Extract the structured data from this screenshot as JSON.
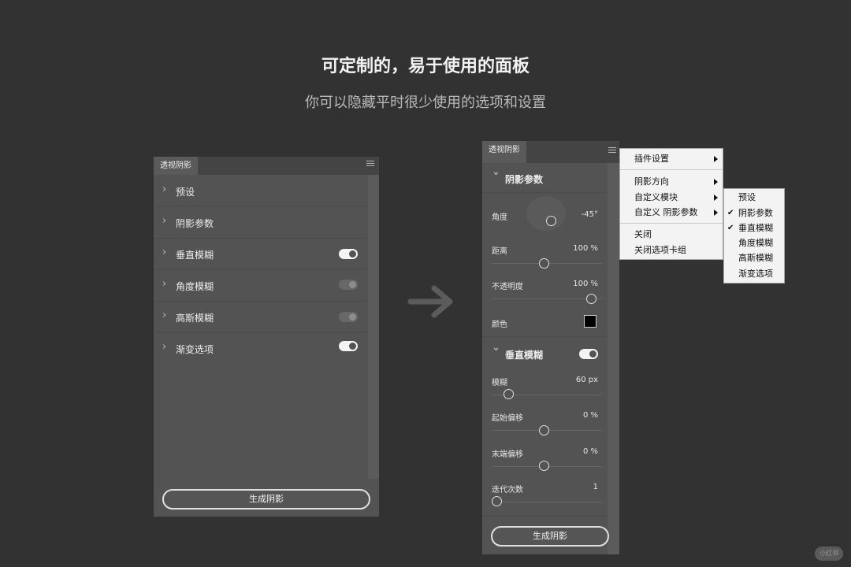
{
  "hero": {
    "title": "可定制的，易于使用的面板",
    "subtitle": "你可以隐藏平时很少使用的选项和设置"
  },
  "simple_panel": {
    "tab_label": "透视阴影",
    "rows": [
      {
        "label": "预设",
        "toggle": null
      },
      {
        "label": "阴影参数",
        "toggle": null
      },
      {
        "label": "垂直模糊",
        "toggle": true
      },
      {
        "label": "角度模糊",
        "toggle": false
      },
      {
        "label": "高斯模糊",
        "toggle": false
      },
      {
        "label": "渐变选项",
        "toggle": true
      }
    ],
    "generate_label": "生成阴影"
  },
  "expanded_panel": {
    "tab_label": "透视阴影",
    "shadow_section": {
      "title": "阴影参数",
      "angle": {
        "label": "角度",
        "value": "-45°"
      },
      "distance": {
        "label": "距离",
        "value": "100 %"
      },
      "opacity": {
        "label": "不透明度",
        "value": "100 %"
      },
      "color": {
        "label": "颜色",
        "value": "#000000"
      }
    },
    "blur_section": {
      "title": "垂直模糊",
      "enabled": true,
      "blur": {
        "label": "模糊",
        "value": "60 px"
      },
      "start_offset": {
        "label": "起始偏移",
        "value": "0 %"
      },
      "end_offset": {
        "label": "末端偏移",
        "value": "0 %"
      },
      "iterations": {
        "label": "迭代次数",
        "value": "1"
      }
    },
    "generate_label": "生成阴影"
  },
  "flyout_menu": {
    "items": [
      {
        "label": "插件设置",
        "submenu": true
      },
      {
        "label": "阴影方向",
        "submenu": true
      },
      {
        "label": "自定义模块",
        "submenu": true
      },
      {
        "label": "自定义 阴影参数",
        "submenu": true
      },
      {
        "label": "关闭",
        "submenu": false
      },
      {
        "label": "关闭选项卡组",
        "submenu": false
      }
    ]
  },
  "submenu": {
    "items": [
      {
        "label": "预设",
        "checked": false
      },
      {
        "label": "阴影参数",
        "checked": true
      },
      {
        "label": "垂直模糊",
        "checked": true
      },
      {
        "label": "角度模糊",
        "checked": false
      },
      {
        "label": "高斯模糊",
        "checked": false
      },
      {
        "label": "渐变选项",
        "checked": false
      }
    ],
    "check_glyph": "✔"
  },
  "watermark": "小红书",
  "colors": {
    "background": "#323232",
    "panel": "#535353",
    "menu": "#f3f3f3"
  }
}
